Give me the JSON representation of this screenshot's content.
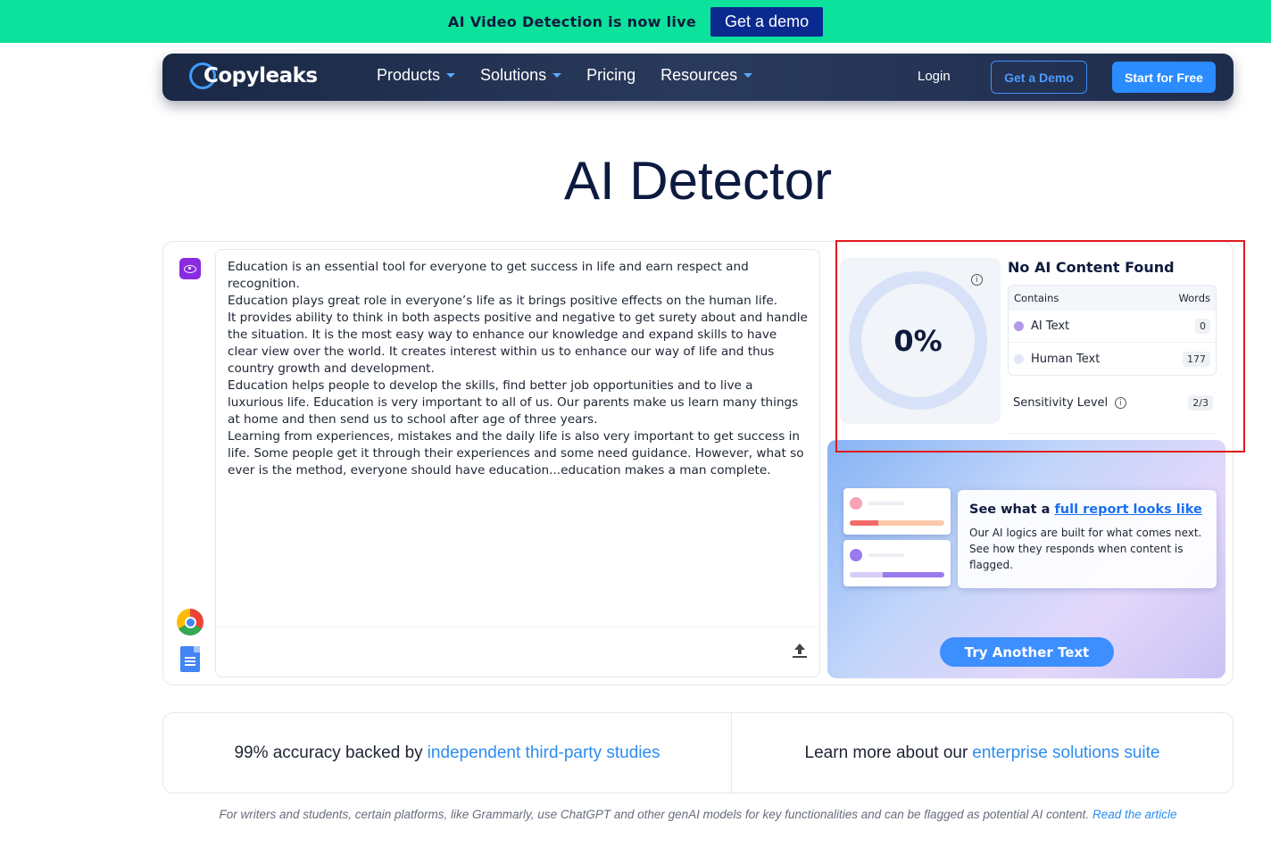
{
  "announcement": {
    "text": "AI Video Detection is now live",
    "cta": "Get a demo"
  },
  "nav": {
    "logo": "Copyleaks",
    "menu": [
      {
        "label": "Products",
        "dropdown": true
      },
      {
        "label": "Solutions",
        "dropdown": true
      },
      {
        "label": "Pricing",
        "dropdown": false
      },
      {
        "label": "Resources",
        "dropdown": true
      }
    ],
    "login": "Login",
    "get_demo": "Get a Demo",
    "start_free": "Start for Free"
  },
  "page": {
    "title": "AI Detector"
  },
  "input": {
    "paragraphs": [
      "Education is an essential tool for everyone to get success in life and earn respect and recognition.",
      "Education plays great role in everyone’s life as it brings positive effects on the human life.",
      "It provides ability to think in both aspects positive and negative to get surety about and handle the situation. It is the most easy way to enhance our knowledge and expand skills to have clear view over the world. It creates interest within us to enhance our way of life and thus country growth and development.",
      "Education helps people to develop the skills, find better job opportunities and to live a luxurious life. Education is very important to all of us. Our parents make us learn many things at home and then send us to school after age of three years.",
      "Learning from experiences, mistakes and the daily life is also very important to get success in life. Some people get it through their experiences and some need guidance. However, what so ever is the method, everyone should have education...education makes a man complete."
    ]
  },
  "results": {
    "percentage": "0%",
    "title": "No AI Content Found",
    "col_contains": "Contains",
    "col_words": "Words",
    "rows": [
      {
        "label": "AI Text",
        "count": "0",
        "color": "#b49ae6"
      },
      {
        "label": "Human Text",
        "count": "177",
        "color": "#e3e8f6"
      }
    ],
    "sensitivity_label": "Sensitivity Level",
    "sensitivity_value": "2/3"
  },
  "promo": {
    "heading_prefix": "See what a ",
    "heading_link": "full report looks like",
    "body": "Our AI logics are built for what comes next. See how they responds when content is flagged.",
    "try_button": "Try Another Text"
  },
  "info": {
    "left_text": "99% accuracy backed by",
    "left_link": "independent third-party studies",
    "right_text": "Learn more about our",
    "right_link": "enterprise solutions suite"
  },
  "disclaimer": {
    "text": "For writers and students, certain platforms, like Grammarly, use ChatGPT and other genAI models for key functionalities and can be flagged as potential AI content.",
    "link": "Read the article"
  },
  "colors": {
    "announce_bg": "#0ce29b",
    "accent": "#2a8cff",
    "highlight": "#e0181d"
  }
}
